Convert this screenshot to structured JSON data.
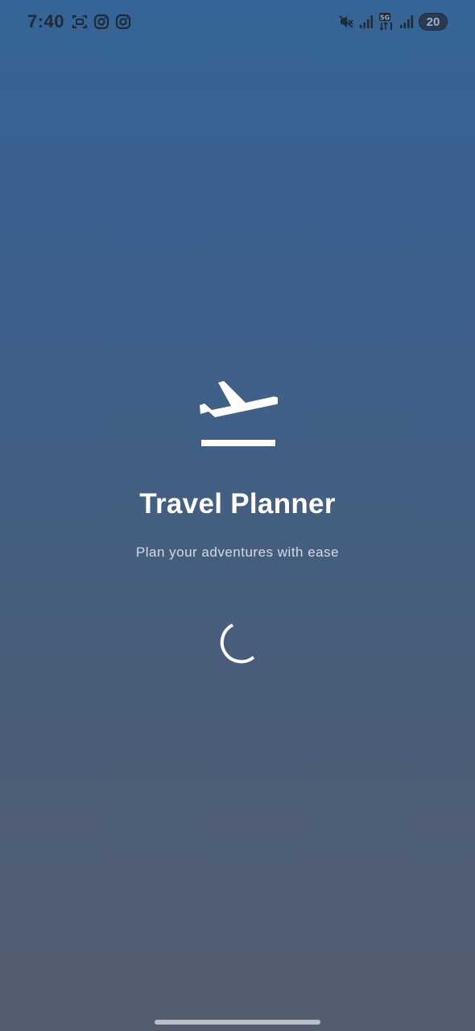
{
  "status_bar": {
    "time": "7:40",
    "left_icons": [
      "screenshot-icon",
      "instagram-icon",
      "instagram-icon"
    ],
    "right_icons": [
      "mute-icon",
      "signal-icon",
      "5g-signal-icon",
      "signal-icon"
    ],
    "battery_level": "20"
  },
  "splash": {
    "logo_icon": "flight-takeoff-icon",
    "title": "Travel Planner",
    "subtitle": "Plan your adventures with ease",
    "loading_indicator": "circular-progress-icon"
  },
  "colors": {
    "background_top": "#356496",
    "background_bottom": "#545e6e",
    "text_primary": "#ffffff",
    "text_secondary": "#d3dae4"
  }
}
